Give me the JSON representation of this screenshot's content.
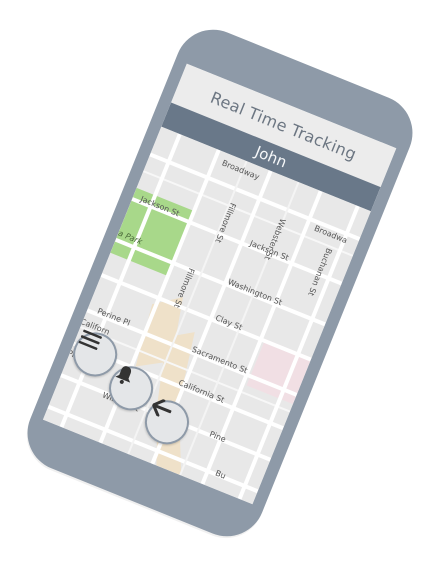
{
  "app": {
    "title": "Real Time Tracking",
    "user_name": "John"
  },
  "map": {
    "streets": {
      "broadway": "Broadway",
      "broadway_right": "Broadwa",
      "fillmore_upper": "Fillmore St",
      "fillmore_lower": "Fillmore St",
      "webster": "Webster St",
      "buchanan": "Buchanan St",
      "jackson_left": "Jackson St",
      "jackson_right": "Jackson St",
      "washington": "Washington St",
      "clay": "Clay St",
      "perine": "Perine Pl",
      "sacramento": "Sacramento St",
      "california_left": "Californ",
      "california": "California St",
      "pine_left": "Pin",
      "pine": "Pine",
      "wilmot": "Wilmot St",
      "bush": "Bu"
    },
    "park_label": "za Park"
  },
  "buttons": {
    "menu_icon": "menu-icon",
    "bell_icon": "bell-icon",
    "back_icon": "back-arrow-icon"
  },
  "colors": {
    "phone_frame": "#8e9aa8",
    "user_bar": "#697889",
    "park": "#a8d88a"
  }
}
